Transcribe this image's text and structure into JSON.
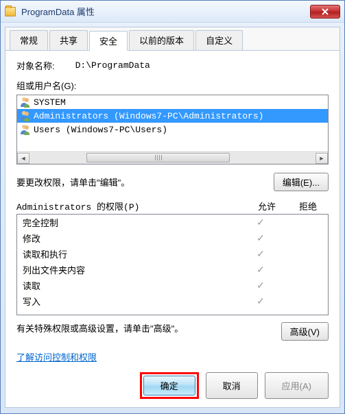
{
  "titlebar": {
    "title": "ProgramData 属性"
  },
  "tabs": [
    {
      "label": "常规"
    },
    {
      "label": "共享"
    },
    {
      "label": "安全",
      "active": true
    },
    {
      "label": "以前的版本"
    },
    {
      "label": "自定义"
    }
  ],
  "object": {
    "label": "对象名称:",
    "path": "D:\\ProgramData"
  },
  "groups": {
    "label": "组或用户名(G):",
    "items": [
      {
        "name": "SYSTEM",
        "selected": false
      },
      {
        "name": "Administrators (Windows7-PC\\Administrators)",
        "selected": true
      },
      {
        "name": "Users (Windows7-PC\\Users)",
        "selected": false
      }
    ]
  },
  "edit": {
    "text": "要更改权限，请单击\"编辑\"。",
    "button": "编辑(E)..."
  },
  "permissions": {
    "header_name": "Administrators 的权限(P)",
    "header_allow": "允许",
    "header_deny": "拒绝",
    "rows": [
      {
        "name": "完全控制",
        "allow": true,
        "deny": false
      },
      {
        "name": "修改",
        "allow": true,
        "deny": false
      },
      {
        "name": "读取和执行",
        "allow": true,
        "deny": false
      },
      {
        "name": "列出文件夹内容",
        "allow": true,
        "deny": false
      },
      {
        "name": "读取",
        "allow": true,
        "deny": false
      },
      {
        "name": "写入",
        "allow": true,
        "deny": false
      }
    ]
  },
  "advanced": {
    "text": "有关特殊权限或高级设置，请单击\"高级\"。",
    "button": "高级(V)"
  },
  "link": "了解访问控制和权限",
  "buttons": {
    "ok": "确定",
    "cancel": "取消",
    "apply": "应用(A)"
  }
}
